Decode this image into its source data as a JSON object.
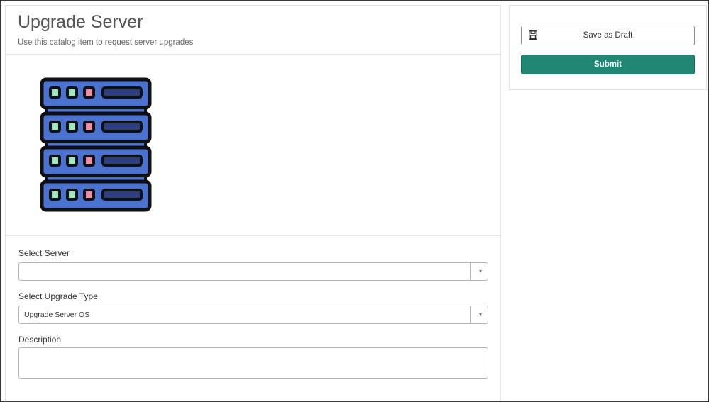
{
  "page": {
    "title": "Upgrade Server",
    "subtitle": "Use this catalog item to request server upgrades",
    "image_icon": "server-rack-icon"
  },
  "form": {
    "server": {
      "label": "Select Server",
      "value": ""
    },
    "upgrade_type": {
      "label": "Select Upgrade Type",
      "value": "Upgrade Server OS"
    },
    "description": {
      "label": "Description",
      "value": ""
    },
    "dropdown_arrow": "▾"
  },
  "actions": {
    "save_draft_label": "Save as Draft",
    "save_icon": "floppy-disk-icon",
    "submit_label": "Submit",
    "submit_color": "#1f8773"
  },
  "colors": {
    "server_blue": "#4a73d1",
    "server_dark": "#2c3e80",
    "led_green": "#9de8c0",
    "led_pink": "#f08aa8"
  }
}
